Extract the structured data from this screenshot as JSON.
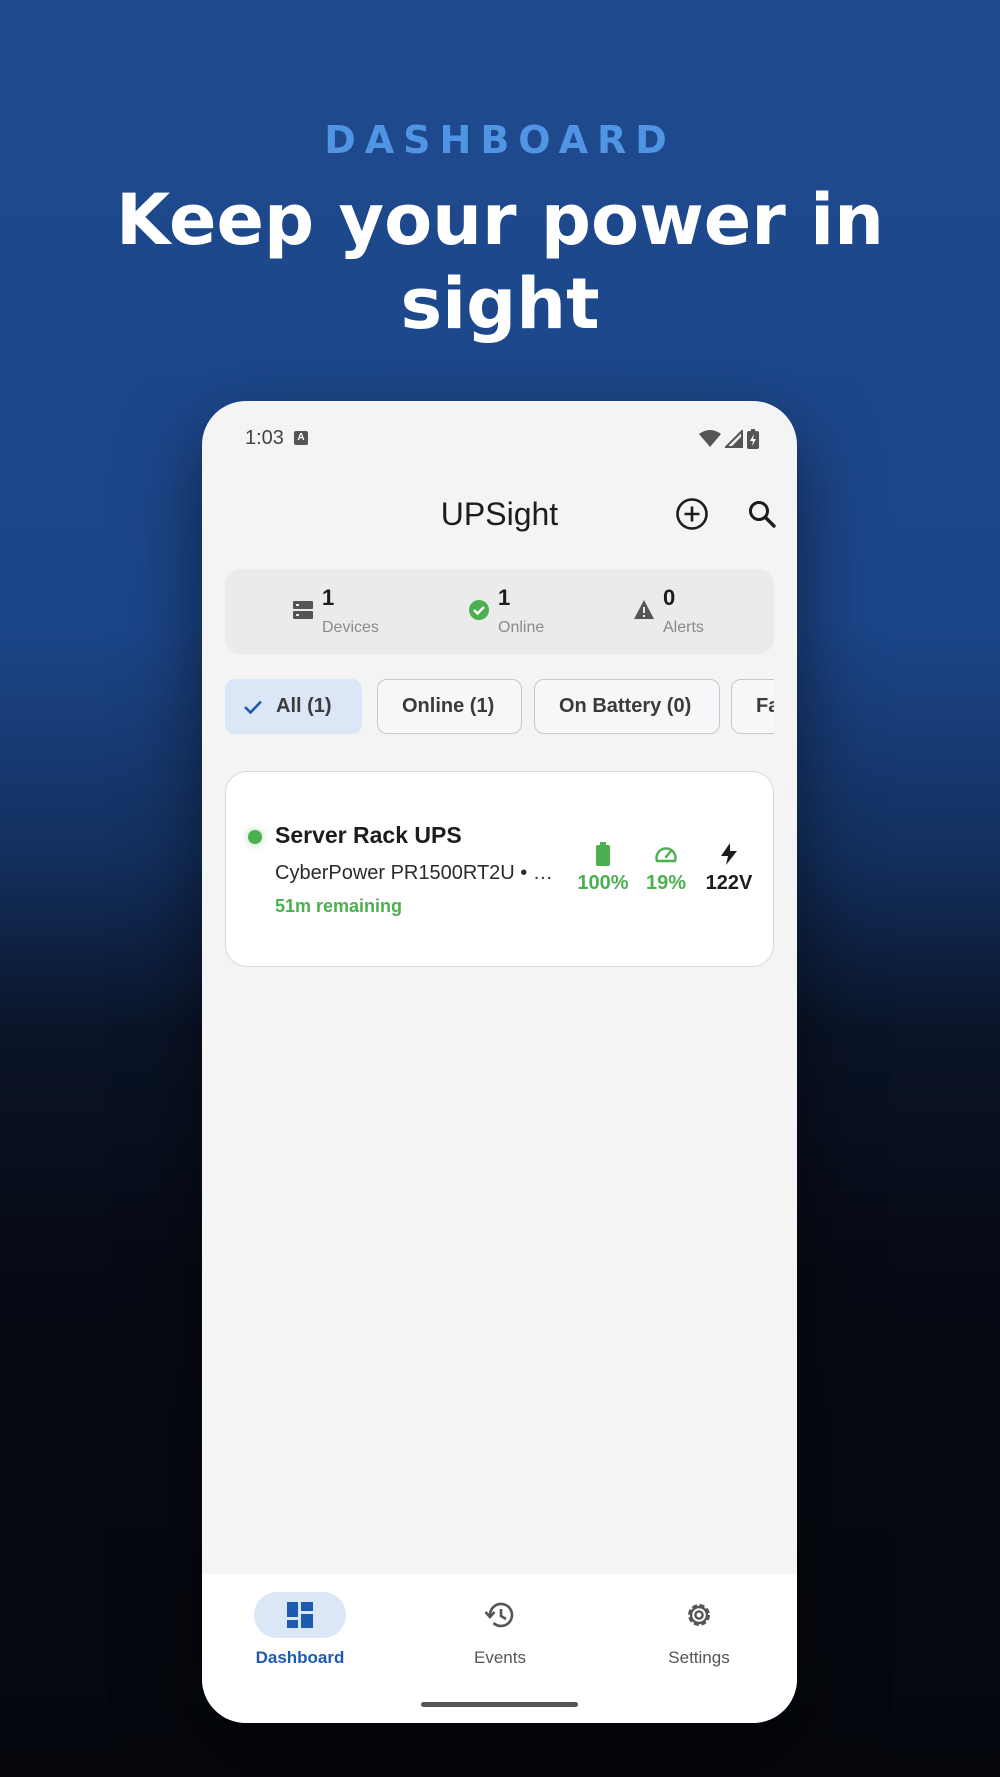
{
  "promo": {
    "eyebrow": "DASHBOARD",
    "headline": "Keep your power in sight"
  },
  "status_bar": {
    "time": "1:03",
    "icons": [
      "notification-a-icon",
      "wifi-icon",
      "signal-icon",
      "battery-charging-icon"
    ]
  },
  "app_bar": {
    "title": "UPSight",
    "actions": [
      "add-circle-icon",
      "search-icon"
    ]
  },
  "summary": {
    "devices": {
      "value": "1",
      "label": "Devices",
      "icon": "server-icon"
    },
    "online": {
      "value": "1",
      "label": "Online",
      "icon": "check-circle-icon"
    },
    "alerts": {
      "value": "0",
      "label": "Alerts",
      "icon": "warning-icon"
    }
  },
  "filters": [
    {
      "label": "All (1)",
      "selected": true
    },
    {
      "label": "Online (1)",
      "selected": false
    },
    {
      "label": "On Battery (0)",
      "selected": false
    },
    {
      "label": "Fa",
      "selected": false
    }
  ],
  "devices": [
    {
      "name": "Server Rack UPS",
      "model": "CyberPower PR1500RT2U • 1…",
      "runtime": "51m remaining",
      "status_color": "#4caf50",
      "battery": "100%",
      "load": "19%",
      "voltage": "122V"
    }
  ],
  "bottom_nav": [
    {
      "label": "Dashboard",
      "icon": "dashboard-icon",
      "active": true
    },
    {
      "label": "Events",
      "icon": "history-icon",
      "active": false
    },
    {
      "label": "Settings",
      "icon": "gear-icon",
      "active": false
    }
  ],
  "colors": {
    "accent": "#1c5bb0",
    "online": "#4caf50",
    "eyebrow": "#4f95e3"
  }
}
